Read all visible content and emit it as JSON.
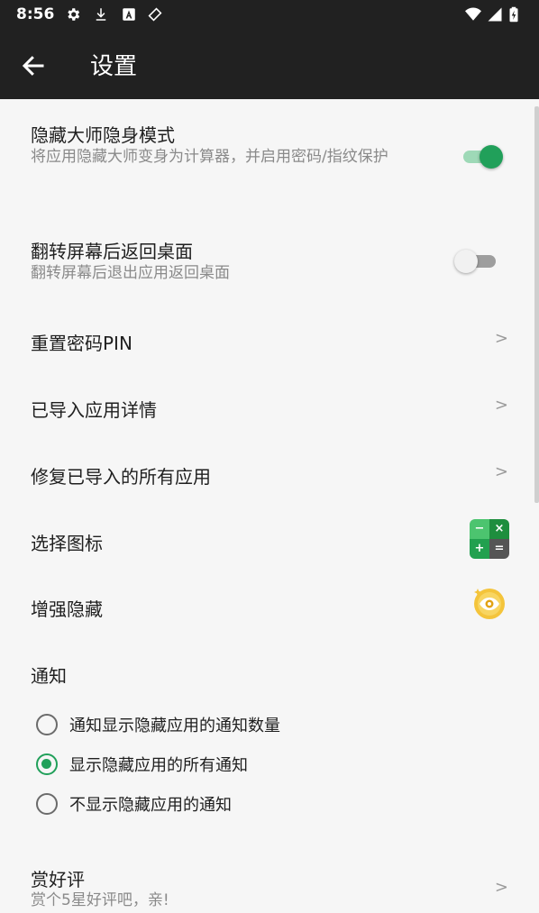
{
  "status_bar": {
    "time": "8:56",
    "icons": [
      "settings-icon",
      "download-icon",
      "a-box-icon",
      "tag-icon",
      "wifi-icon",
      "signal-icon",
      "battery-icon"
    ]
  },
  "app_bar": {
    "title": "设置",
    "back_icon": "arrow-left-icon"
  },
  "colors": {
    "accent": "#21a05a",
    "header_bg": "#212121",
    "background": "#f6f6f6"
  },
  "settings": {
    "hide_master": {
      "title": "隐藏大师隐身模式",
      "subtitle": "将应用隐藏大师变身为计算器，并启用密码/指纹保护",
      "enabled": true
    },
    "flip_screen": {
      "title": "翻转屏幕后返回桌面",
      "subtitle": "翻转屏幕后退出应用返回桌面",
      "enabled": false
    },
    "reset_pin": {
      "title": "重置密码PIN",
      "chevron": ">"
    },
    "imported_apps": {
      "title": "已导入应用详情",
      "chevron": ">"
    },
    "repair_apps": {
      "title": "修复已导入的所有应用",
      "chevron": ">"
    },
    "choose_icon": {
      "title": "选择图标",
      "icon_symbols": {
        "minus": "−",
        "times": "×",
        "plus": "+",
        "equals": "="
      }
    },
    "enhance_hide": {
      "title": "增强隐藏"
    },
    "notification": {
      "title": "通知",
      "options": [
        {
          "label": "通知显示隐藏应用的通知数量",
          "selected": false
        },
        {
          "label": "显示隐藏应用的所有通知",
          "selected": true
        },
        {
          "label": "不显示隐藏应用的通知",
          "selected": false
        }
      ]
    },
    "rate": {
      "title": "赏好评",
      "subtitle": "赏个5星好评吧，亲!",
      "chevron": ">"
    }
  }
}
